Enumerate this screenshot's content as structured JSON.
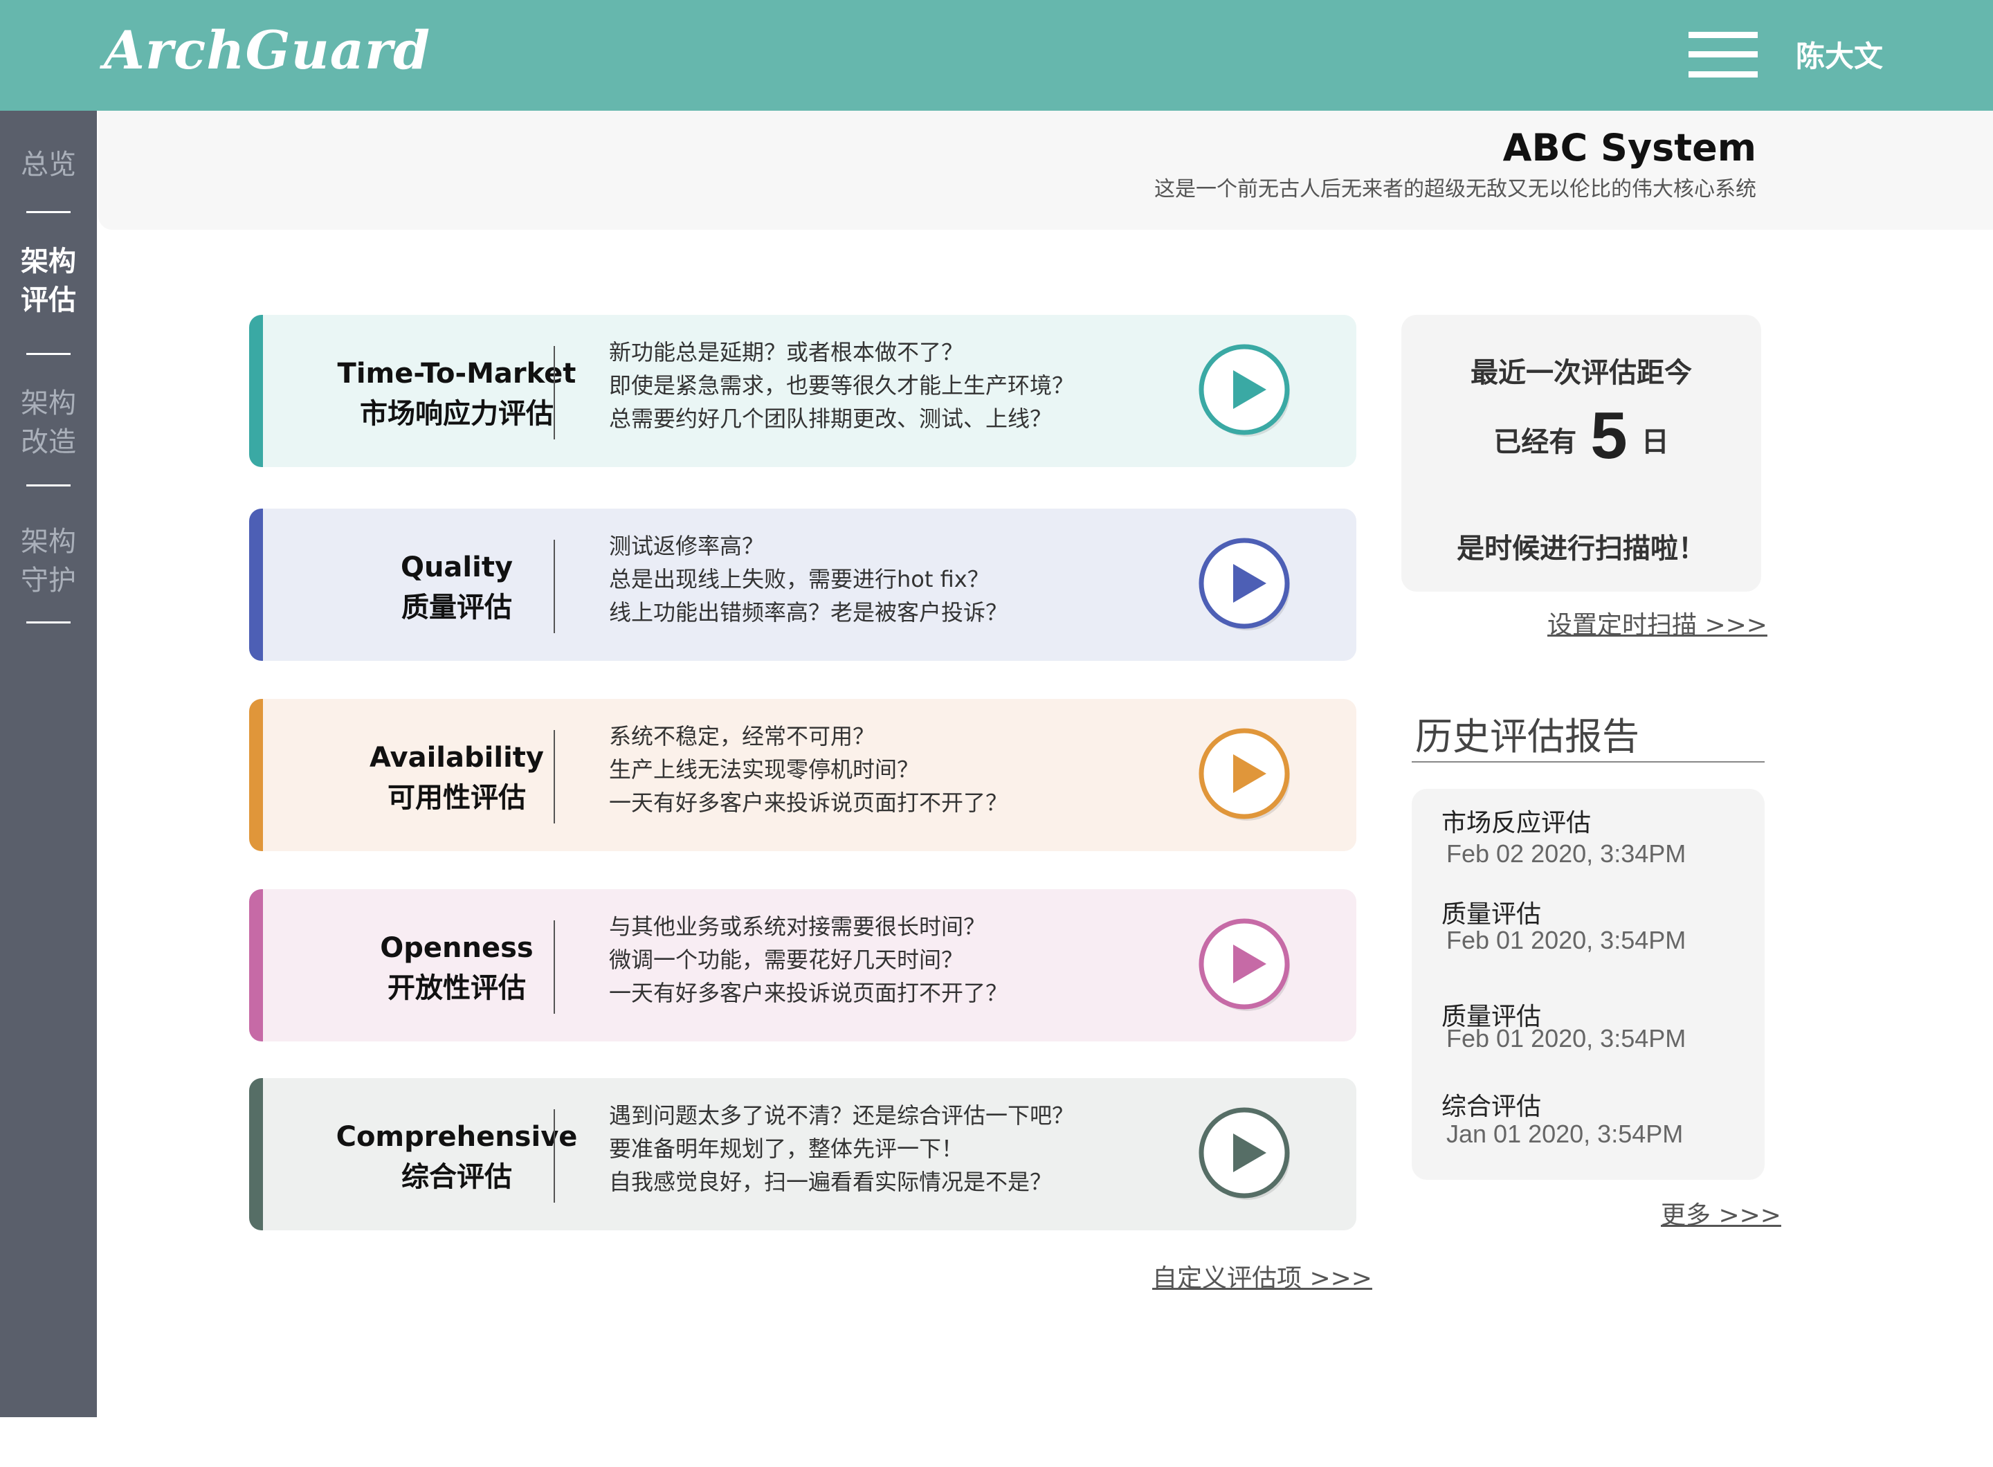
{
  "app": {
    "logo": "ArchGuard",
    "user": "陈大文"
  },
  "sidebar": {
    "items": [
      {
        "label": "总览"
      },
      {
        "label": "架构评估",
        "active": true
      },
      {
        "label": "架构改造"
      },
      {
        "label": "架构守护"
      }
    ],
    "settings_icon": "gear-icon"
  },
  "header": {
    "title": "ABC System",
    "subtitle": "这是一个前无古人后无来者的超级无敌又无以伦比的伟大核心系统"
  },
  "evaluations": [
    {
      "title_en": "Time-To-Market",
      "title_cn": "市场响应力评估",
      "color": "#3aa9a4",
      "bg": "#eaf6f5",
      "lines": [
        "新功能总是延期？或者根本做不了？",
        "即使是紧急需求，也要等很久才能上生产环境？",
        "总需要约好几个团队排期更改、测试、上线？"
      ]
    },
    {
      "title_en": "Quality",
      "title_cn": "质量评估",
      "color": "#4d5fb5",
      "bg": "#eaedf6",
      "lines": [
        "测试返修率高？",
        "总是出现线上失败，需要进行hot fix？",
        "线上功能出错频率高？老是被客户投诉？"
      ]
    },
    {
      "title_en": "Availability",
      "title_cn": "可用性评估",
      "color": "#e0963a",
      "bg": "#fbf1ea",
      "lines": [
        "系统不稳定，经常不可用？",
        "生产上线无法实现零停机时间？",
        "一天有好多客户来投诉说页面打不开了？"
      ]
    },
    {
      "title_en": "Openness",
      "title_cn": "开放性评估",
      "color": "#c66aa6",
      "bg": "#f8edf3",
      "lines": [
        "与其他业务或系统对接需要很长时间？",
        "微调一个功能，需要花好几天时间？",
        "一天有好多客户来投诉说页面打不开了？"
      ]
    },
    {
      "title_en": "Comprehensive",
      "title_cn": "综合评估",
      "color": "#566e66",
      "bg": "#eef0ef",
      "lines": [
        "遇到问题太多了说不清？还是综合评估一下吧？",
        "要准备明年规划了，整体先评一下！",
        "自我感觉良好，扫一遍看看实际情况是不是？"
      ]
    }
  ],
  "custom_link": "自定义评估项 >>>",
  "last_scan": {
    "line1": "最近一次评估距今",
    "prefix": "已经有",
    "days": "5",
    "suffix": "日",
    "line3": "是时候进行扫描啦！",
    "schedule_link": "设置定时扫描 >>>"
  },
  "history": {
    "title": "历史评估报告",
    "items": [
      {
        "name": "市场反应评估",
        "time": "Feb 02 2020, 3:34PM"
      },
      {
        "name": "质量评估",
        "time": "Feb 01 2020, 3:54PM"
      },
      {
        "name": "质量评估",
        "time": "Feb 01 2020, 3:54PM"
      },
      {
        "name": "综合评估",
        "time": "Jan 01 2020, 3:54PM"
      }
    ],
    "more_link": "更多 >>>"
  }
}
